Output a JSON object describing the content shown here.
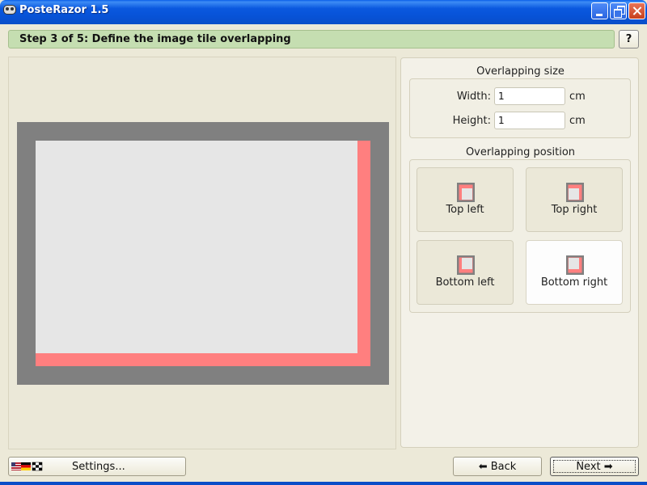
{
  "window": {
    "title": "PosteRazor 1.5",
    "icon": "app-face-icon"
  },
  "step": {
    "title": "Step 3 of 5: Define the image tile overlapping",
    "help_label": "?"
  },
  "overlapping_size": {
    "title": "Overlapping size",
    "width_label": "Width:",
    "width_value": "1",
    "width_unit": "cm",
    "height_label": "Height:",
    "height_value": "1",
    "height_unit": "cm"
  },
  "overlapping_position": {
    "title": "Overlapping position",
    "selected": "bottom-right",
    "options": [
      {
        "label": "Top left",
        "id": "top-left"
      },
      {
        "label": "Top right",
        "id": "top-right"
      },
      {
        "label": "Bottom left",
        "id": "bottom-left"
      },
      {
        "label": "Bottom right",
        "id": "bottom-right"
      }
    ]
  },
  "footer": {
    "settings_label": "Settings...",
    "back_label": "Back",
    "next_label": "Next",
    "back_icon": "arrow-left-icon",
    "next_icon": "arrow-right-icon",
    "settings_icon": "flags-icon"
  },
  "colors": {
    "overlap": "#ff7f7f",
    "paper": "#808080",
    "tile": "#e6e6e6",
    "step_bar": "#c5deb1",
    "title_bar": "#0752d6"
  }
}
